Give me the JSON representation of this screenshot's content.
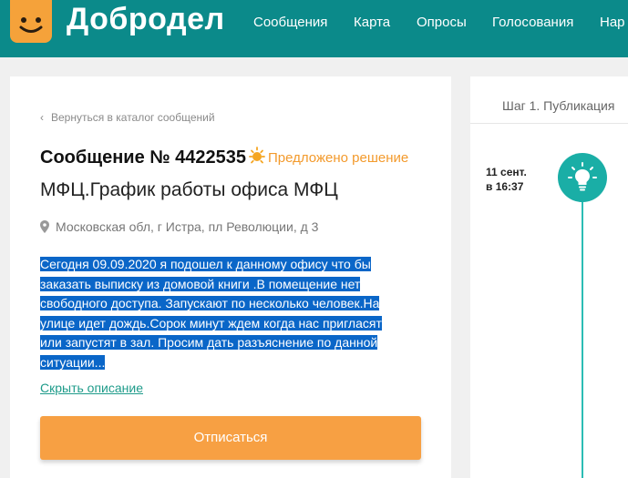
{
  "header": {
    "brand": "Добродел",
    "nav": [
      "Сообщения",
      "Карта",
      "Опросы",
      "Голосования",
      "Нар"
    ]
  },
  "message": {
    "back_link": "Вернуться в каталог сообщений",
    "title": "Сообщение № 4422535",
    "status": "Предложено решение",
    "subject": "МФЦ.График работы офиса МФЦ",
    "address": "Московская обл, г Истра, пл Революции, д 3",
    "description_lines": [
      "Сегодня 09.09.2020 я подошел к данному офису что бы",
      "заказать выписку из домовой книги .В помещение нет",
      "свободного доступа. Запускают по несколько человек.На",
      "улице идет дождь.Сорок минут ждем когда нас пригласят",
      "или запустят в зал. Просим дать разъяснение по данной",
      "ситуации..."
    ],
    "hide_link": "Скрыть описание",
    "unsubscribe_button": "Отписаться"
  },
  "timeline": {
    "step_label": "Шаг 1. Публикация",
    "date_line1": "11 сент.",
    "date_line2": "в 16:37"
  },
  "colors": {
    "header_bg": "#0b8a8a",
    "accent_orange": "#f7a043",
    "teal": "#1aaea6",
    "selection": "#0a66c8"
  },
  "icons": {
    "logo": "smiley-logo-icon",
    "status": "sun-icon",
    "address": "map-pin-icon",
    "back": "chevron-left-icon",
    "timeline": "lightbulb-icon"
  }
}
